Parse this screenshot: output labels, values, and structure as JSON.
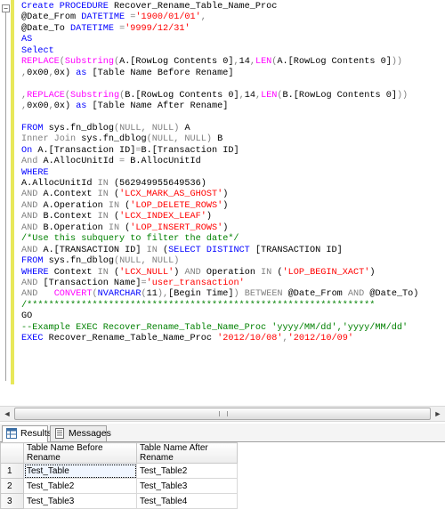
{
  "editor": {
    "collapse_glyph": "−",
    "lines": [
      [
        [
          "kw",
          "Create PROCEDURE"
        ],
        [
          "tx",
          " Recover_Rename_Table_Name_Proc"
        ]
      ],
      [
        [
          "tx",
          "@Date_From "
        ],
        [
          "kw",
          "DATETIME"
        ],
        [
          "op",
          " ="
        ],
        [
          "str",
          "'1900/01/01'"
        ],
        [
          "op",
          ","
        ]
      ],
      [
        [
          "tx",
          "@Date_To "
        ],
        [
          "kw",
          "DATETIME"
        ],
        [
          "op",
          " ="
        ],
        [
          "str",
          "'9999/12/31'"
        ]
      ],
      [
        [
          "kw",
          "AS"
        ]
      ],
      [
        [
          "kw",
          "Select"
        ]
      ],
      [
        [
          "fn",
          "REPLACE"
        ],
        [
          "op",
          "("
        ],
        [
          "fn",
          "Substring"
        ],
        [
          "op",
          "("
        ],
        [
          "tx",
          "A.[RowLog Contents 0]"
        ],
        [
          "op",
          ","
        ],
        [
          "tx",
          "14"
        ],
        [
          "op",
          ","
        ],
        [
          "fn",
          "LEN"
        ],
        [
          "op",
          "("
        ],
        [
          "tx",
          "A.[RowLog Contents 0]"
        ],
        [
          "op",
          "))"
        ]
      ],
      [
        [
          "op",
          ","
        ],
        [
          "tx",
          "0x00"
        ],
        [
          "op",
          ","
        ],
        [
          "tx",
          "0x) "
        ],
        [
          "kw",
          "as"
        ],
        [
          "tx",
          " [Table Name Before Rename]"
        ]
      ],
      [
        [
          "tx",
          ""
        ]
      ],
      [
        [
          "op",
          ","
        ],
        [
          "fn",
          "REPLACE"
        ],
        [
          "op",
          "("
        ],
        [
          "fn",
          "Substring"
        ],
        [
          "op",
          "("
        ],
        [
          "tx",
          "B.[RowLog Contents 0]"
        ],
        [
          "op",
          ","
        ],
        [
          "tx",
          "14"
        ],
        [
          "op",
          ","
        ],
        [
          "fn",
          "LEN"
        ],
        [
          "op",
          "("
        ],
        [
          "tx",
          "B.[RowLog Contents 0]"
        ],
        [
          "op",
          "))"
        ]
      ],
      [
        [
          "op",
          ","
        ],
        [
          "tx",
          "0x00"
        ],
        [
          "op",
          ","
        ],
        [
          "tx",
          "0x) "
        ],
        [
          "kw",
          "as"
        ],
        [
          "tx",
          " [Table Name After Rename]"
        ]
      ],
      [
        [
          "tx",
          ""
        ]
      ],
      [
        [
          "kw",
          "FROM"
        ],
        [
          "tx",
          " sys.fn_dblog"
        ],
        [
          "op",
          "("
        ],
        [
          "op",
          "NULL, NULL"
        ],
        [
          "op",
          ")"
        ],
        [
          "tx",
          " A"
        ]
      ],
      [
        [
          "op",
          "Inner Join"
        ],
        [
          "tx",
          " sys.fn_dblog"
        ],
        [
          "op",
          "("
        ],
        [
          "op",
          "NULL, NULL"
        ],
        [
          "op",
          ")"
        ],
        [
          "tx",
          " B"
        ]
      ],
      [
        [
          "kw",
          "On"
        ],
        [
          "tx",
          " A.[Transaction ID]"
        ],
        [
          "op",
          "="
        ],
        [
          "tx",
          "B.[Transaction ID]"
        ]
      ],
      [
        [
          "op",
          "And"
        ],
        [
          "tx",
          " A.AllocUnitId "
        ],
        [
          "op",
          "="
        ],
        [
          "tx",
          " B.AllocUnitId"
        ]
      ],
      [
        [
          "kw",
          "WHERE"
        ]
      ],
      [
        [
          "tx",
          "A.AllocUnitId "
        ],
        [
          "op",
          "IN"
        ],
        [
          "tx",
          " (562949955649536)"
        ]
      ],
      [
        [
          "op",
          "AND"
        ],
        [
          "tx",
          " A.Context "
        ],
        [
          "op",
          "IN"
        ],
        [
          "tx",
          " ("
        ],
        [
          "str",
          "'LCX_MARK_AS_GHOST'"
        ],
        [
          "tx",
          ")"
        ]
      ],
      [
        [
          "op",
          "AND"
        ],
        [
          "tx",
          " A.Operation "
        ],
        [
          "op",
          "IN"
        ],
        [
          "tx",
          " ("
        ],
        [
          "str",
          "'LOP_DELETE_ROWS'"
        ],
        [
          "tx",
          ")"
        ]
      ],
      [
        [
          "op",
          "AND"
        ],
        [
          "tx",
          " B.Context "
        ],
        [
          "op",
          "IN"
        ],
        [
          "tx",
          " ("
        ],
        [
          "str",
          "'LCX_INDEX_LEAF'"
        ],
        [
          "tx",
          ")"
        ]
      ],
      [
        [
          "op",
          "AND"
        ],
        [
          "tx",
          " B.Operation "
        ],
        [
          "op",
          "IN"
        ],
        [
          "tx",
          " ("
        ],
        [
          "str",
          "'LOP_INSERT_ROWS'"
        ],
        [
          "tx",
          ")"
        ]
      ],
      [
        [
          "cm",
          "/*Use this subquery to filter the date*/"
        ]
      ],
      [
        [
          "op",
          "AND"
        ],
        [
          "tx",
          " A.[TRANSACTION ID] "
        ],
        [
          "op",
          "IN"
        ],
        [
          "tx",
          " ("
        ],
        [
          "kw",
          "SELECT DISTINCT"
        ],
        [
          "tx",
          " [TRANSACTION ID]"
        ]
      ],
      [
        [
          "kw",
          "FROM"
        ],
        [
          "tx",
          " sys.fn_dblog"
        ],
        [
          "op",
          "("
        ],
        [
          "op",
          "NULL, NULL"
        ],
        [
          "op",
          ")"
        ]
      ],
      [
        [
          "kw",
          "WHERE"
        ],
        [
          "tx",
          " Context "
        ],
        [
          "op",
          "IN"
        ],
        [
          "tx",
          " ("
        ],
        [
          "str",
          "'LCX_NULL'"
        ],
        [
          "tx",
          ") "
        ],
        [
          "op",
          "AND"
        ],
        [
          "tx",
          " Operation "
        ],
        [
          "op",
          "IN"
        ],
        [
          "tx",
          " ("
        ],
        [
          "str",
          "'LOP_BEGIN_XACT'"
        ],
        [
          "tx",
          ")"
        ]
      ],
      [
        [
          "op",
          "AND"
        ],
        [
          "tx",
          " [Transaction Name]"
        ],
        [
          "op",
          "="
        ],
        [
          "str",
          "'user_transaction'"
        ]
      ],
      [
        [
          "op",
          "AND"
        ],
        [
          "tx",
          "   "
        ],
        [
          "fn",
          "CONVERT"
        ],
        [
          "op",
          "("
        ],
        [
          "kw",
          "NVARCHAR"
        ],
        [
          "op",
          "("
        ],
        [
          "tx",
          "11"
        ],
        [
          "op",
          "),"
        ],
        [
          "tx",
          "[Begin Time]"
        ],
        [
          "op",
          ")"
        ],
        [
          "tx",
          " "
        ],
        [
          "op",
          "BETWEEN"
        ],
        [
          "tx",
          " @Date_From "
        ],
        [
          "op",
          "AND"
        ],
        [
          "tx",
          " @Date_To)"
        ]
      ],
      [
        [
          "cm",
          "/****************************************************************"
        ]
      ],
      [
        [
          "tx",
          "GO"
        ]
      ],
      [
        [
          "cm",
          "--Example EXEC Recover_Rename_Table_Name_Proc 'yyyy/MM/dd','yyyy/MM/dd'"
        ]
      ],
      [
        [
          "kw",
          "EXEC"
        ],
        [
          "tx",
          " Recover_Rename_Table_Name_Proc "
        ],
        [
          "str",
          "'2012/10/08'"
        ],
        [
          "op",
          ","
        ],
        [
          "str",
          "'2012/10/09'"
        ]
      ]
    ]
  },
  "scrollbar": {
    "left_arrow": "◄",
    "right_arrow": "►"
  },
  "tabs": [
    {
      "label": "Results",
      "icon": "results-grid-icon",
      "active": true
    },
    {
      "label": "Messages",
      "icon": "messages-icon",
      "active": false
    }
  ],
  "results": {
    "columns": [
      "Table Name Before Rename",
      "Table Name After Rename"
    ],
    "rows": [
      {
        "num": "1",
        "before": "Test_Table",
        "after": "Test_Table2"
      },
      {
        "num": "2",
        "before": "Test_Table2",
        "after": "Test_Table3"
      },
      {
        "num": "3",
        "before": "Test_Table3",
        "after": "Test_Table4"
      }
    ]
  },
  "colors": {
    "keyword": "#0000ff",
    "function": "#ff00ff",
    "string": "#ff0000",
    "operator": "#808080",
    "comment": "#008000",
    "change_bar": "#e8e85a"
  }
}
